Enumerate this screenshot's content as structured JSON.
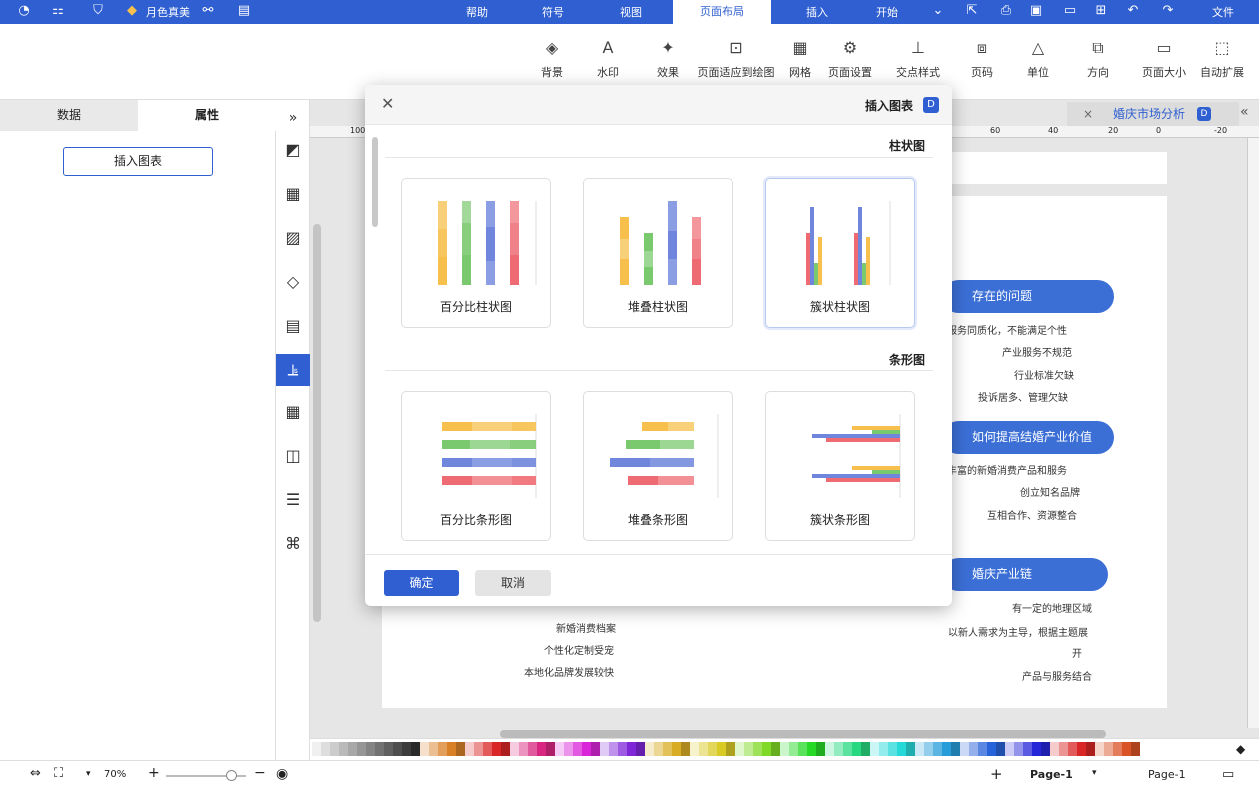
{
  "menubar": {
    "items": [
      {
        "id": "file",
        "label": "文件"
      },
      {
        "id": "start",
        "label": "开始"
      },
      {
        "id": "insert",
        "label": "插入"
      },
      {
        "id": "page_layout",
        "label": "页面布局"
      },
      {
        "id": "view",
        "label": "视图"
      },
      {
        "id": "symbol",
        "label": "符号"
      },
      {
        "id": "help",
        "label": "帮助"
      }
    ],
    "active": "页面布局",
    "brand": "月色真美"
  },
  "ribbon": {
    "items": [
      {
        "label": "自动扩展",
        "icon": "auto-expand-icon",
        "glyph": "⬚"
      },
      {
        "label": "页面大小",
        "icon": "page-size-icon",
        "glyph": "▭"
      },
      {
        "label": "方向",
        "icon": "orientation-icon",
        "glyph": "⧉"
      },
      {
        "label": "单位",
        "icon": "unit-icon",
        "glyph": "△"
      },
      {
        "label": "页码",
        "icon": "page-number-icon",
        "glyph": "⧈"
      },
      {
        "label": "交点样式",
        "icon": "intersection-icon",
        "glyph": "⊥"
      },
      {
        "label": "页面设置",
        "icon": "page-setup-icon",
        "glyph": "⚙"
      },
      {
        "label": "网格",
        "icon": "grid-icon",
        "glyph": "▦"
      },
      {
        "label": "页面适应到绘图",
        "icon": "fit-page-icon",
        "glyph": "⊡"
      },
      {
        "label": "效果",
        "icon": "effect-icon",
        "glyph": "✦"
      },
      {
        "label": "水印",
        "icon": "watermark-icon",
        "glyph": "A"
      },
      {
        "label": "背景",
        "icon": "background-icon",
        "glyph": "◈"
      }
    ]
  },
  "panel": {
    "tab_attr": "属性",
    "tab_data": "数据",
    "insert_chart_btn": "插入图表"
  },
  "document": {
    "tab_title": "婚庆市场分析",
    "ruler_ticks": [
      "-20",
      "0",
      "20",
      "40",
      "60",
      "80",
      "100"
    ],
    "sections": [
      {
        "title": "存在的问题",
        "lines": [
          "服务同质化，不能满足个性",
          "产业服务不规范",
          "行业标准欠缺",
          "投诉居多、管理欠缺"
        ]
      },
      {
        "title": "如何提高结婚产业价值",
        "lines": [
          "丰富的新婚消费产品和服务",
          "创立知名品牌",
          "互相合作、资源整合"
        ]
      },
      {
        "title": "婚庆产业链",
        "lines": [
          "有一定的地理区域",
          "以新人需求为主导，根据主题展",
          "开",
          "产品与服务结合"
        ]
      }
    ],
    "left_lines": [
      "新婚消费档案",
      "个性化定制受宠",
      "本地化品牌发展较快"
    ]
  },
  "dialog": {
    "title": "插入图表",
    "section_bar": "柱状图",
    "section_hbar": "条形图",
    "cards_bar": [
      {
        "label": "簇状柱状图",
        "selected": true
      },
      {
        "label": "堆叠柱状图",
        "selected": false
      },
      {
        "label": "百分比柱状图",
        "selected": false
      }
    ],
    "cards_hbar": [
      {
        "label": "簇状条形图"
      },
      {
        "label": "堆叠条形图"
      },
      {
        "label": "百分比条形图"
      }
    ],
    "confirm": "确定",
    "cancel": "取消"
  },
  "statusbar": {
    "page_left": "Page-1",
    "page_right": "Page-1",
    "zoom": "70%"
  },
  "colors": {
    "accent": "#2f5fd0",
    "red": "#ef6b73",
    "blue": "#6f86dc",
    "green": "#7bc96f",
    "yellow": "#f7c04d"
  }
}
